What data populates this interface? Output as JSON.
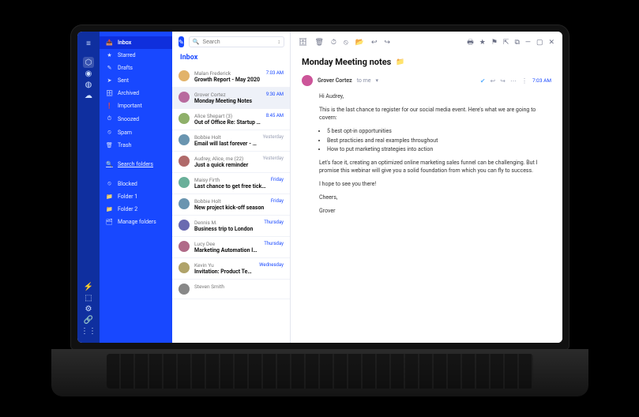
{
  "rail": {
    "top_icon": "≡",
    "apps": [
      "⬡",
      "◉",
      "◍",
      "☁"
    ],
    "bottom": [
      "⚡",
      "⬚",
      "⚙",
      "🔗",
      "⋮⋮"
    ]
  },
  "sidebar": {
    "main": [
      {
        "icon": "📥",
        "label": "Inbox",
        "active": true
      },
      {
        "icon": "★",
        "label": "Starred"
      },
      {
        "icon": "✎",
        "label": "Drafts"
      },
      {
        "icon": "➤",
        "label": "Sent"
      },
      {
        "icon": "🗄",
        "label": "Archived"
      },
      {
        "icon": "❗",
        "label": "Important"
      },
      {
        "icon": "⏱",
        "label": "Snoozed"
      },
      {
        "icon": "⦸",
        "label": "Spam"
      },
      {
        "icon": "🗑",
        "label": "Trash"
      }
    ],
    "search_folders": {
      "icon": "🔍",
      "label": "Search folders"
    },
    "folders": [
      {
        "icon": "⦸",
        "label": "Blocked"
      },
      {
        "icon": "📁",
        "label": "Folder 1"
      },
      {
        "icon": "📁",
        "label": "Folder 2"
      },
      {
        "icon": "🗂",
        "label": "Manage folders"
      }
    ]
  },
  "list": {
    "compose_icon": "✎",
    "search": {
      "icon": "🔍",
      "placeholder": "Search",
      "sort_icon": "↕"
    },
    "title": "Inbox",
    "messages": [
      {
        "sender": "Malan Frederick",
        "subject": "Growth Report - May 2020",
        "time": "7:03 AM",
        "time_style": "blue",
        "avatar": "#e2b36a"
      },
      {
        "sender": "Grover Cortez",
        "subject": "Monday Meeting Notes",
        "time": "9:30 AM",
        "time_style": "blue",
        "avatar": "#b86a9e",
        "selected": true
      },
      {
        "sender": "Alice Shepart (3)",
        "subject": "Out of Office Re: Startup Ne…",
        "time": "8:45 AM",
        "time_style": "blue",
        "avatar": "#8fb06a"
      },
      {
        "sender": "Bobbie Holt",
        "subject": "Email will last forever - on…",
        "time": "Yesterday",
        "time_style": "gray",
        "avatar": "#6a95b0"
      },
      {
        "sender": "Audrey, Alice, me (22)",
        "subject": "Just a quick reminder",
        "time": "Yesterday",
        "time_style": "gray",
        "avatar": "#b06a6a"
      },
      {
        "sender": "Maisy Firth",
        "subject": "Last chance to get free tickets!",
        "time": "Friday",
        "time_style": "blue",
        "avatar": "#6ab09a"
      },
      {
        "sender": "Bobbie Holt",
        "subject": "New project kick-off season",
        "time": "Friday",
        "time_style": "blue",
        "avatar": "#6a95b0"
      },
      {
        "sender": "Dennis M.",
        "subject": "Business trip to London",
        "time": "Thursday",
        "time_style": "blue",
        "avatar": "#6a6ab0"
      },
      {
        "sender": "Lucy Dee",
        "subject": "Marketing Automation Info",
        "time": "Thursday",
        "time_style": "blue",
        "avatar": "#b06a88"
      },
      {
        "sender": "Kevin Yu",
        "subject": "Invitation: Product Team Meeting",
        "time": "Wednesday",
        "time_style": "blue",
        "avatar": "#b0a36a"
      },
      {
        "sender": "Steven Smith",
        "subject": "",
        "time": "",
        "time_style": "gray",
        "avatar": "#888"
      }
    ]
  },
  "toolbar": {
    "left": [
      {
        "name": "archive-icon",
        "glyph": "🗄"
      },
      {
        "name": "trash-icon",
        "glyph": "🗑"
      },
      {
        "name": "clock-icon",
        "glyph": "⏱"
      },
      {
        "name": "spam-icon",
        "glyph": "⦸"
      },
      {
        "name": "move-icon",
        "glyph": "📂"
      },
      {
        "name": "reply-icon",
        "glyph": "↩"
      },
      {
        "name": "forward-icon",
        "glyph": "↪"
      }
    ],
    "right": [
      {
        "name": "print-icon",
        "glyph": "🖶"
      },
      {
        "name": "star-icon",
        "glyph": "★"
      },
      {
        "name": "flag-icon",
        "glyph": "⚑"
      },
      {
        "name": "collapse-icon",
        "glyph": "⇱"
      },
      {
        "name": "popout-icon",
        "glyph": "⧉"
      },
      {
        "name": "minimize-icon",
        "glyph": "—"
      },
      {
        "name": "maximize-icon",
        "glyph": "▢"
      },
      {
        "name": "close-icon",
        "glyph": "✕"
      }
    ]
  },
  "message": {
    "title": "Monday Meeting notes",
    "title_tag_icon": "📁",
    "from": "Grover Cortez",
    "to": "to me",
    "dropdown": "▾",
    "reactions": [
      "✔",
      "↩",
      "↪",
      "⋯",
      "⋮"
    ],
    "time": "7:03 AM",
    "body": {
      "greeting": "Hi Audrey,",
      "p1": "This is the last chance to register for our social media event. Here's what we are going to covern:",
      "bullets": [
        "5 best opt-in opportunities",
        "Best practicies and real examples throughout",
        "How to put marketing strategies into action"
      ],
      "p2": "Let's face it, creating an optimized online marketing sales funnel can be challenging. But I promise this webinar will give you a solid foundation from which you can fly to success.",
      "p3": "I hope to see you there!",
      "sig1": "Cheers,",
      "sig2": "Grover"
    }
  }
}
